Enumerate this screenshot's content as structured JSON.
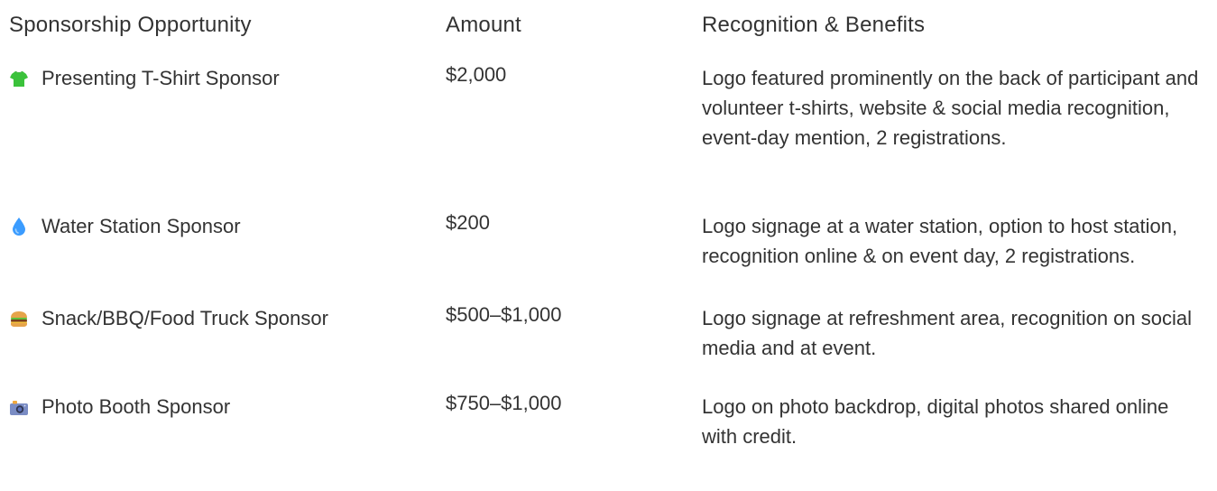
{
  "headers": {
    "opportunity": "Sponsorship Opportunity",
    "amount": "Amount",
    "benefits": "Recognition & Benefits"
  },
  "rows": [
    {
      "icon": "t-shirt-icon",
      "opportunity": "Presenting T-Shirt Sponsor",
      "amount": "$2,000",
      "benefits": "Logo featured prominently on the back of participant and volunteer t-shirts, website & social media recognition, event-day mention, 2 registrations."
    },
    {
      "icon": "water-drop-icon",
      "opportunity": "Water Station Sponsor",
      "amount": "$200",
      "benefits": "Logo signage at a water station, option to host station, recognition online & on event day, 2 registrations."
    },
    {
      "icon": "burger-icon",
      "opportunity": "Snack/BBQ/Food Truck Sponsor",
      "amount": "$500–$1,000",
      "benefits": "Logo signage at refreshment area, recognition on social media and at event."
    },
    {
      "icon": "camera-icon",
      "opportunity": "Photo Booth Sponsor",
      "amount": "$750–$1,000",
      "benefits": "Logo on photo backdrop, digital photos shared online with credit."
    }
  ],
  "colors": {
    "text": "#333333",
    "tshirt": "#3bc23b",
    "water": "#3b9cff",
    "burger_bun": "#e6a44a",
    "camera": "#7a8cc4"
  }
}
